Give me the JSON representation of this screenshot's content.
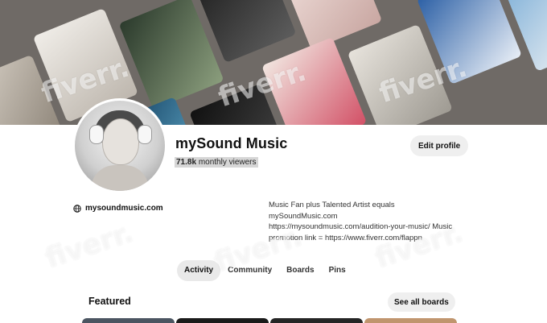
{
  "profile": {
    "name": "mySound Music",
    "viewers_count": "71.8k",
    "viewers_label": "monthly viewers",
    "edit_label": "Edit profile",
    "website": "mysoundmusic.com",
    "bio": [
      "Music Fan plus Talented Artist equals",
      "mySoundMusic.com",
      "https://mysoundmusic.com/audition-your-music/ Music",
      "promotion link = https://www.fiverr.com/flappn"
    ]
  },
  "tabs": [
    {
      "label": "Activity",
      "active": true
    },
    {
      "label": "Community",
      "active": false
    },
    {
      "label": "Boards",
      "active": false
    },
    {
      "label": "Pins",
      "active": false
    }
  ],
  "featured": {
    "title": "Featured",
    "see_all_label": "See all boards"
  },
  "watermark": "fiverr.",
  "icons": {
    "website": "globe-icon"
  },
  "colors": {
    "button_bg": "#efefef",
    "active_tab_bg": "#e9e9e9",
    "text": "#111111"
  }
}
